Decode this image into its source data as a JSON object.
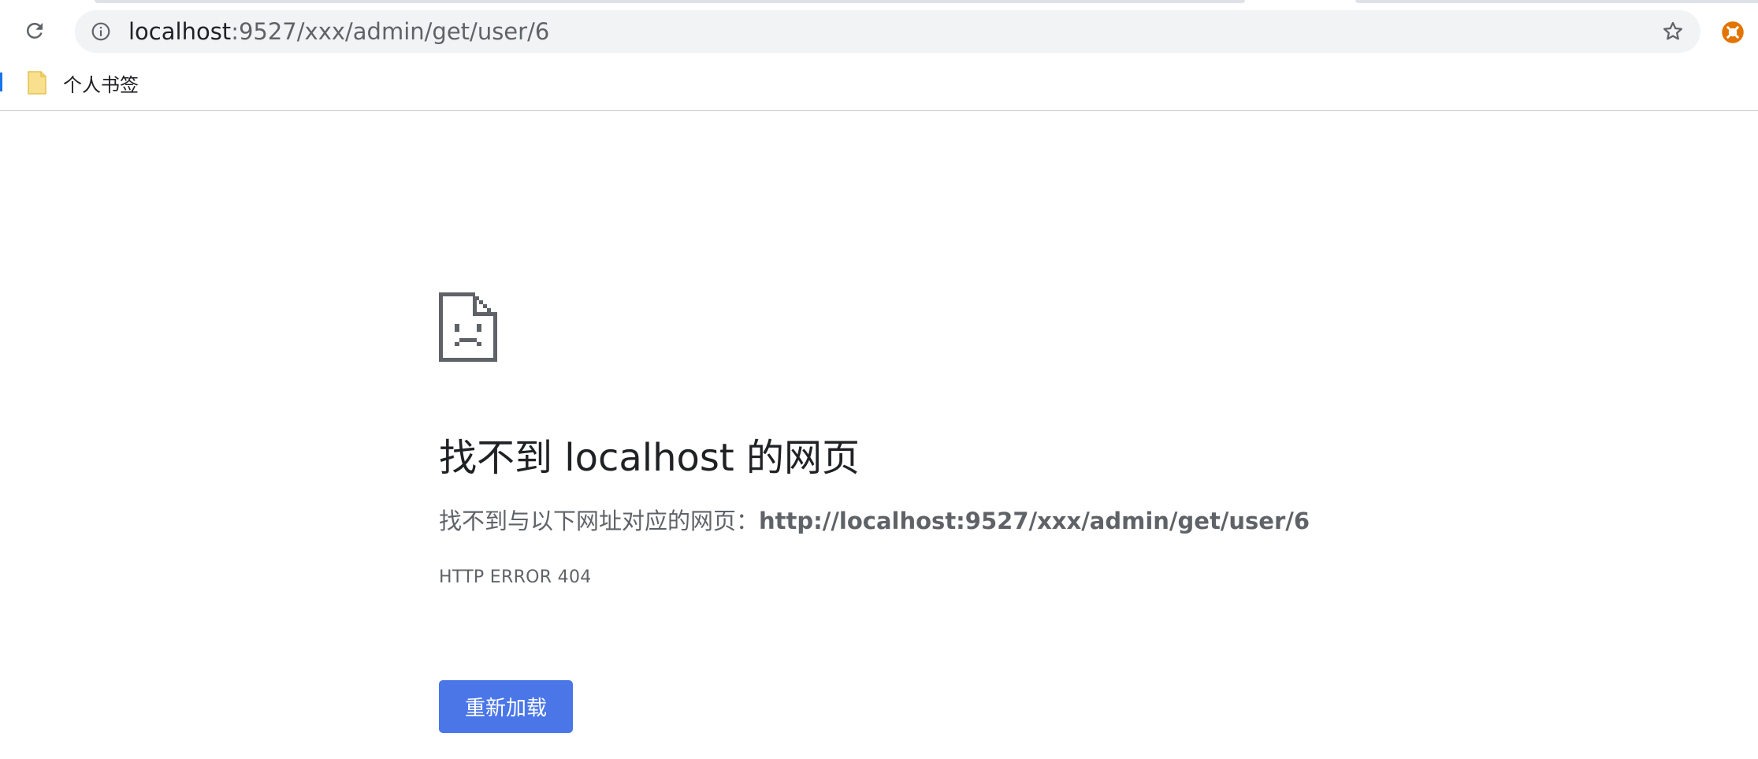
{
  "toolbar": {
    "url_host": "localhost",
    "url_path": ":9527/xxx/admin/get/user/6"
  },
  "bookmarks": [
    {
      "label": "个人书签"
    }
  ],
  "error_page": {
    "heading": "找不到 localhost 的网页",
    "desc_prefix": "找不到与以下网址对应的网页：",
    "desc_url": "http://localhost:9527/xxx/admin/get/user/6",
    "error_code": "HTTP ERROR 404",
    "reload_label": "重新加载"
  },
  "icons": {
    "reload": "reload-icon",
    "info": "info-icon",
    "star": "star-icon",
    "extension": "extension-icon",
    "folder": "folder-icon",
    "sad_page": "sad-page-icon"
  },
  "colors": {
    "button": "#4a76e8",
    "omnibox": "#f1f3f4",
    "extension": "#e37400"
  }
}
